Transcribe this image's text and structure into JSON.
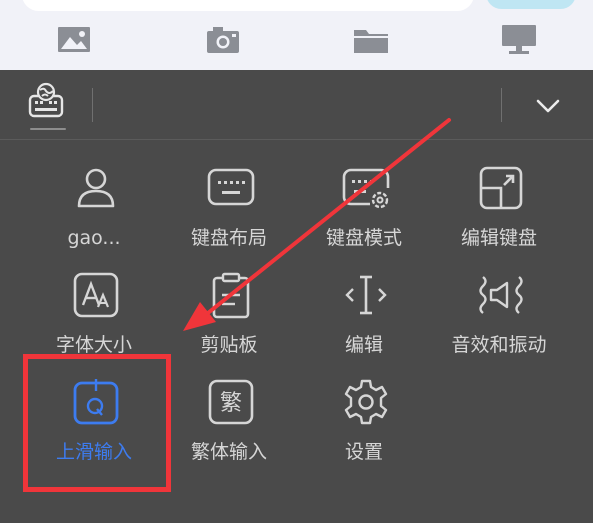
{
  "attach_bar": {
    "items": [
      {
        "name": "image-icon"
      },
      {
        "name": "camera-icon"
      },
      {
        "name": "folder-icon"
      },
      {
        "name": "computer-icon"
      }
    ]
  },
  "toolbar": {
    "logo_icon": "keyboard-globe-icon",
    "collapse_icon": "chevron-down-icon"
  },
  "menu": {
    "items": [
      {
        "label": "gao...",
        "icon": "user-icon"
      },
      {
        "label": "键盘布局",
        "icon": "keyboard-layout-icon"
      },
      {
        "label": "键盘模式",
        "icon": "keyboard-mode-icon"
      },
      {
        "label": "编辑键盘",
        "icon": "edit-keyboard-icon"
      },
      {
        "label": "字体大小",
        "icon": "font-size-icon"
      },
      {
        "label": "剪贴板",
        "icon": "clipboard-icon"
      },
      {
        "label": "编辑",
        "icon": "edit-cursor-icon"
      },
      {
        "label": "音效和振动",
        "icon": "sound-vibration-icon"
      },
      {
        "label": "上滑输入",
        "icon": "swipe-input-icon",
        "active": true
      },
      {
        "label": "繁体输入",
        "icon": "traditional-chinese-icon",
        "glyph": "繁"
      },
      {
        "label": "设置",
        "icon": "settings-icon"
      }
    ]
  },
  "colors": {
    "panel_bg": "#4a4a4a",
    "icon_stroke": "#d6d6d6",
    "active_blue": "#3d7cf0",
    "annotation_red": "#f0353a",
    "top_strip_bg": "#f1f2f8"
  }
}
